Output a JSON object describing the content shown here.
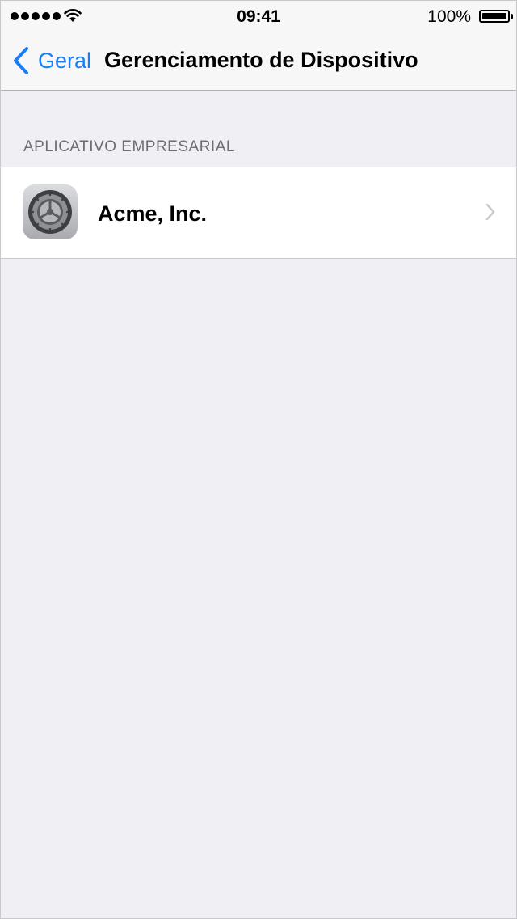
{
  "status_bar": {
    "time": "09:41",
    "battery_percent": "100%",
    "signal_bars": 5
  },
  "nav": {
    "back_label": "Geral",
    "title": "Gerenciamento de Dispositivo"
  },
  "section": {
    "header": "APLICATIVO EMPRESARIAL",
    "items": [
      {
        "label": "Acme, Inc.",
        "icon": "settings-gear-icon"
      }
    ]
  },
  "colors": {
    "accent": "#1a7ff6",
    "background": "#efeff4",
    "section_header": "#6d6d72",
    "chevron": "#c7c7cc"
  }
}
